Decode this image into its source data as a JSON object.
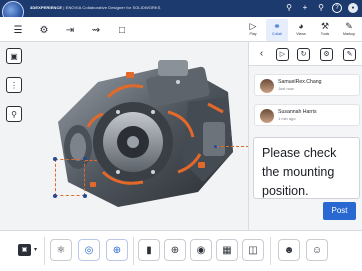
{
  "app": {
    "brand": "3DEXPERIENCE",
    "subtitle": "| ENOVIA Collaborative Designer for SOLIDWORKS"
  },
  "topbar_icons": [
    "search-icon",
    "plus-icon",
    "share-icon",
    "help-icon",
    "user-avatar"
  ],
  "toolbar": {
    "left_icons": [
      "hierarchy-icon",
      "settings-icon",
      "import-icon",
      "share-tree-icon",
      "select-box-icon"
    ],
    "tabs": [
      {
        "label": "Play",
        "icon": "play-icon",
        "active": false
      },
      {
        "label": "Collab",
        "icon": "collab-icon",
        "active": true
      },
      {
        "label": "Views",
        "icon": "views-icon",
        "active": false
      },
      {
        "label": "Tools",
        "icon": "tools-icon",
        "active": false
      },
      {
        "label": "Markup",
        "icon": "markup-icon",
        "active": false
      }
    ]
  },
  "comments": [
    {
      "name": "SamuelRex.Chang",
      "time": "Just now"
    },
    {
      "name": "Susannah Harris",
      "time": "1 min ago"
    }
  ],
  "message": "Please check the mounting position.",
  "post_label": "Post",
  "colors": {
    "accent": "#2a68d1",
    "topbar": "#1d3a6e",
    "annotation": "#e2692a"
  }
}
